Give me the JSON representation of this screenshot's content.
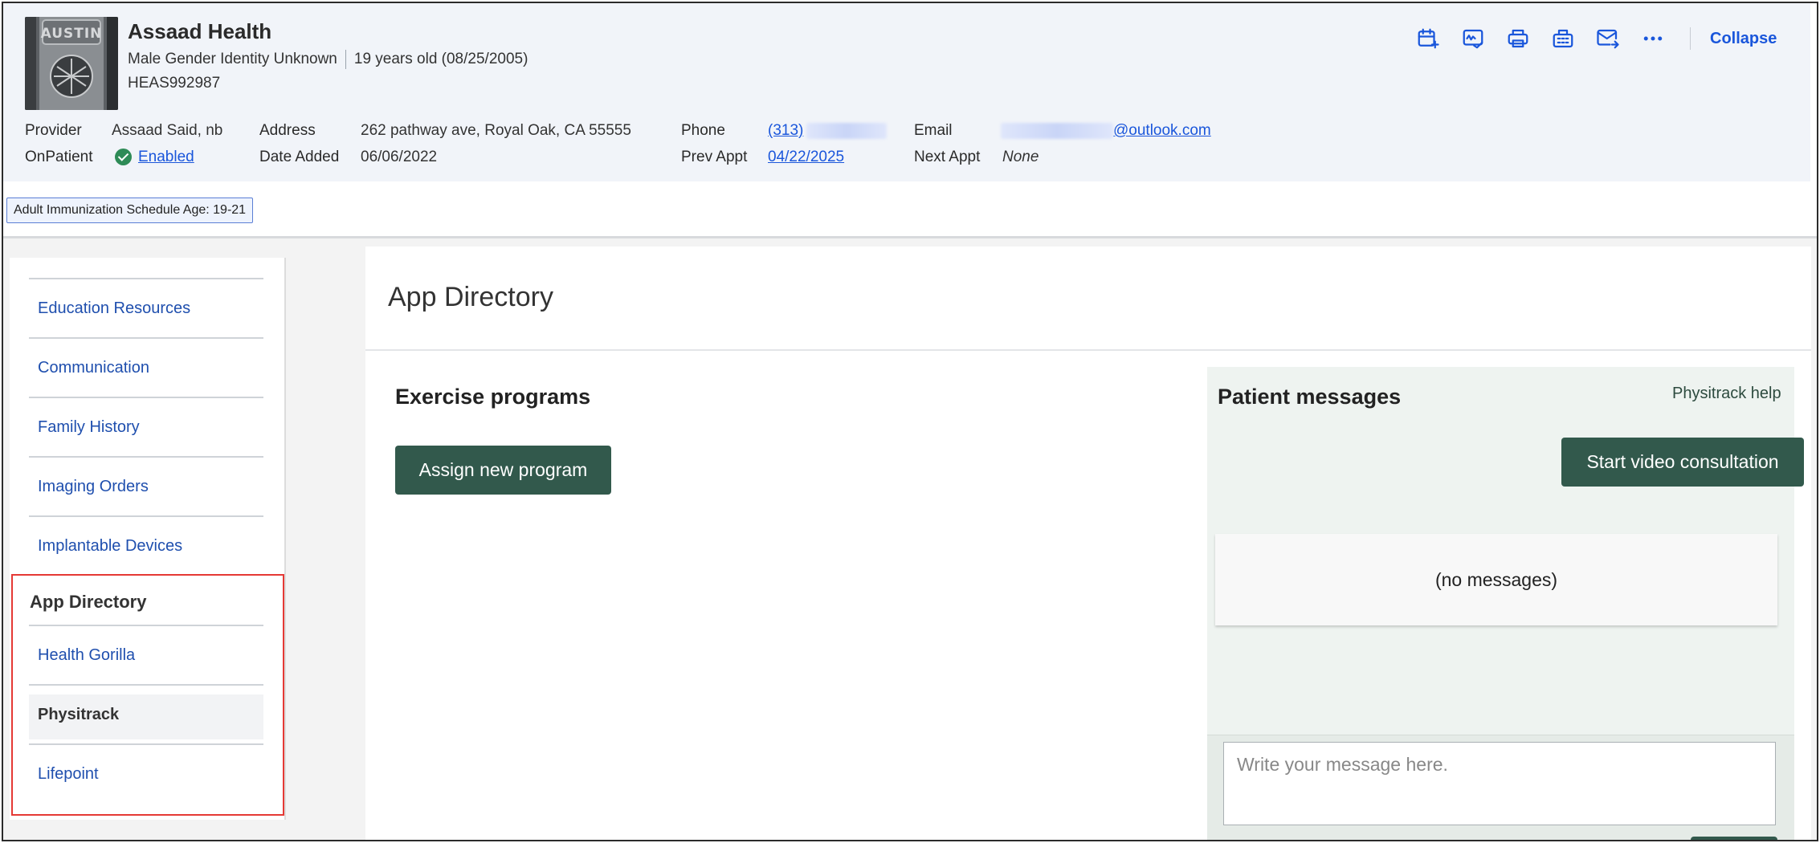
{
  "patient": {
    "name": "Assaad Health",
    "gender_line": "Male Gender Identity Unknown",
    "age_line": "19 years old (08/25/2005)",
    "id": "HEAS992987",
    "avatar_text": "AUSTIN",
    "details": {
      "provider_label": "Provider",
      "provider_value": "Assaad Said, nb",
      "onpatient_label": "OnPatient",
      "onpatient_value": "Enabled",
      "address_label": "Address",
      "address_value": "262 pathway ave, Royal Oak, CA 55555",
      "date_added_label": "Date Added",
      "date_added_value": "06/06/2022",
      "phone_label": "Phone",
      "phone_value": "(313)",
      "prev_appt_label": "Prev Appt",
      "prev_appt_value": "04/22/2025",
      "email_label": "Email",
      "email_value": "@outlook.com",
      "next_appt_label": "Next Appt",
      "next_appt_value": "None"
    }
  },
  "toolbar": {
    "icons": [
      "calendar-add-icon",
      "signature-check-icon",
      "printer-icon",
      "fax-icon",
      "email-send-icon",
      "more-options-icon"
    ],
    "collapse_label": "Collapse"
  },
  "alert_tag": "Adult Immunization Schedule Age: 19-21",
  "sidebar": {
    "items": [
      "Education Resources",
      "Communication",
      "Family History",
      "Imaging Orders",
      "Implantable Devices"
    ],
    "app_directory_heading": "App Directory",
    "app_items": [
      "Health Gorilla",
      "Physitrack",
      "Lifepoint"
    ],
    "active_item": "Physitrack"
  },
  "main": {
    "title": "App Directory",
    "exercise": {
      "title": "Exercise programs",
      "assign_button": "Assign new program"
    },
    "messages": {
      "title": "Patient messages",
      "help_link": "Physitrack help",
      "video_button": "Start video consultation",
      "empty_text": "(no messages)",
      "compose_placeholder": "Write your message here."
    }
  },
  "colors": {
    "header_bg": "#f1f4f9",
    "link": "#1a56db",
    "sidebar_link": "#1f4fae",
    "primary_button": "#32594c",
    "messages_bg": "#eef3f0",
    "highlight_border": "#e53935"
  }
}
